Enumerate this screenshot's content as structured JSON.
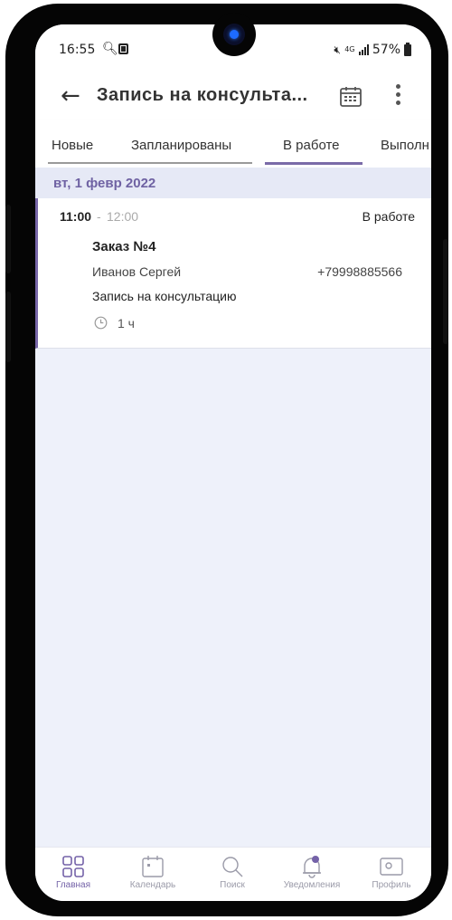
{
  "status_bar": {
    "time": "16:55",
    "network": "4G",
    "battery": "57%"
  },
  "app_bar": {
    "title": "Запись на консульта...",
    "back_icon": "arrow-left-icon",
    "calendar_icon": "calendar-icon",
    "more_icon": "more-vertical-icon"
  },
  "tabs": [
    {
      "label": "Новые"
    },
    {
      "label": "Запланированы"
    },
    {
      "label": "В работе",
      "active": true
    },
    {
      "label": "Выполн"
    }
  ],
  "date_header": "вт, 1 февр 2022",
  "order": {
    "time_start": "11:00",
    "time_sep": "-",
    "time_end": "12:00",
    "status": "В работе",
    "title": "Заказ №4",
    "client_name": "Иванов Сергей",
    "client_phone": "+79998885566",
    "service": "Запись на консультацию",
    "duration": "1 ч"
  },
  "bottom_nav": [
    {
      "label": "Главная",
      "icon": "home-grid-icon",
      "active": true
    },
    {
      "label": "Календарь",
      "icon": "calendar-icon"
    },
    {
      "label": "Поиск",
      "icon": "search-icon"
    },
    {
      "label": "Уведомления",
      "icon": "bell-icon"
    },
    {
      "label": "Профиль",
      "icon": "profile-card-icon"
    }
  ],
  "colors": {
    "accent": "#7462a8",
    "background": "#eef1fa",
    "date_header_bg": "#e6e9f6"
  }
}
